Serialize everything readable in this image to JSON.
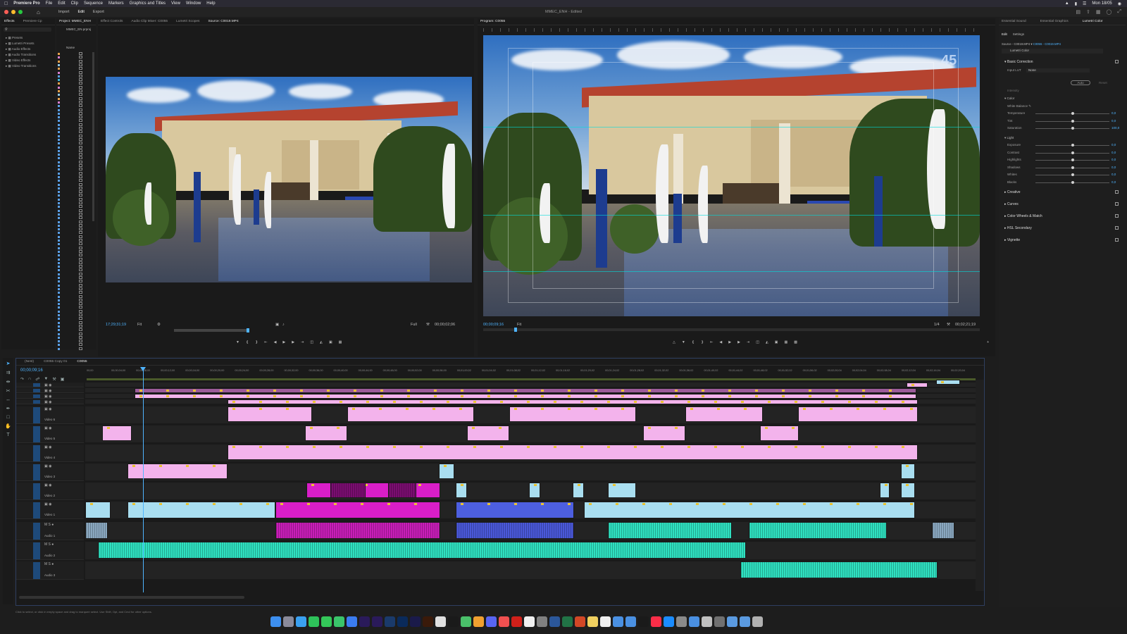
{
  "menubar": {
    "apple": "",
    "app_name": "Premiere Pro",
    "items": [
      "File",
      "Edit",
      "Clip",
      "Sequence",
      "Markers",
      "Graphics and Titles",
      "View",
      "Window",
      "Help"
    ],
    "clock": "Mon 18/05"
  },
  "header": {
    "modes": [
      "Import",
      "Edit",
      "Export"
    ],
    "active_mode": "Edit",
    "doc_title": "MMEC_ENH - Edited"
  },
  "effects_panel": {
    "tabs": [
      "Effects",
      "Premiere Cp"
    ],
    "tree": [
      "Presets",
      "Lumetri Presets",
      "Audio Effects",
      "Audio Transitions",
      "Video Effects",
      "Video Transitions"
    ]
  },
  "project_panel": {
    "title": "Project: MMEC_ENH",
    "file": "MMEC_EN.prproj",
    "column": "Name"
  },
  "source_monitor": {
    "tabs": [
      "Effect Controls",
      "Audio Clip Mixer: C0055",
      "Lumetri Scopes",
      "Source: C0019.MP4"
    ],
    "timecode_in": "17;29;31;19",
    "fit": "Fit",
    "quality": "Full",
    "duration": "00;00;02;06"
  },
  "program_monitor": {
    "title": "Program: C0055",
    "timecode": "00;00;09;16",
    "fit": "Fit",
    "quality": "1/4",
    "duration": "00;02;21;19",
    "watermark": "45"
  },
  "lumetri": {
    "tabs": [
      "Essential Sound",
      "Essential Graphics",
      "Lumetri Color"
    ],
    "subtabs": [
      "Edit",
      "Settings"
    ],
    "source": "Source - C0019.MP4",
    "target": "C0055 - C0019.MP4",
    "preset": "Lumetri Color",
    "sections": [
      "Basic Correction",
      "Creative",
      "Curves",
      "Color Wheels & Match",
      "HSL Secondary",
      "Vignette"
    ],
    "input_lut_label": "Input LUT",
    "input_lut_value": "None",
    "auto_label": "Auto",
    "reset_label": "Reset",
    "intensity_label": "Intensity",
    "color_label": "Color",
    "white_balance_label": "White Balance",
    "color_sliders": [
      {
        "label": "Temperature",
        "value": "0,0",
        "pos": 0.5
      },
      {
        "label": "Tint",
        "value": "0,0",
        "pos": 0.5
      },
      {
        "label": "Saturation",
        "value": "100,0",
        "pos": 0.5
      }
    ],
    "light_label": "Light",
    "light_sliders": [
      {
        "label": "Exposure",
        "value": "0,0",
        "pos": 0.5
      },
      {
        "label": "Contrast",
        "value": "0,0",
        "pos": 0.5
      },
      {
        "label": "Highlights",
        "value": "0,0",
        "pos": 0.5
      },
      {
        "label": "Shadows",
        "value": "0,0",
        "pos": 0.5
      },
      {
        "label": "Whites",
        "value": "0,0",
        "pos": 0.5
      },
      {
        "label": "Blacks",
        "value": "0,0",
        "pos": 0.5
      }
    ]
  },
  "timeline": {
    "tabs": [
      "(Nest)",
      "C0055 Copy 01",
      "C0055"
    ],
    "active_tab": "C0055",
    "timecode": "00;00;09;16",
    "ruler": [
      "00;00",
      "00;00;04;00",
      "00;00;08;00",
      "00;00;12;00",
      "00;00;16;00",
      "00;00;20;00",
      "00;00;24;00",
      "00;00;28;00",
      "00;00;32;00",
      "00;00;36;00",
      "00;00;40;00",
      "00;00;44;00",
      "00;00;48;00",
      "00;00;52;00",
      "00;00;56;00",
      "00;01;00;02",
      "00;01;04;02",
      "00;01;08;02",
      "00;01;12;02",
      "00;01;16;02",
      "00;01;20;02",
      "00;01;24;02",
      "00;01;28;02",
      "00;01;32;02",
      "00;01;36;02",
      "00;01;40;02",
      "00;01;44;02",
      "00;01;48;02",
      "00;01;52;02",
      "00;01;56;02",
      "00;02;00;04",
      "00;02;04;04",
      "00;02;08;04",
      "00;02;12;04",
      "00;02;16;04",
      "00;02;20;04"
    ],
    "video_tracks": [
      "Video 6",
      "Video 5",
      "Video 4",
      "Video 3",
      "Video 2",
      "Video 1"
    ],
    "audio_tracks": [
      "Audio 1",
      "Audio 2",
      "Audio 3"
    ]
  },
  "status": {
    "hint": "Click to select, or click in empty space and drag to marquee select. Use Shift, Opt, and Cmd for other options."
  },
  "dock_apps": [
    "finder",
    "launchpad",
    "safari",
    "whatsapp",
    "messages",
    "facetime",
    "mail",
    "after-effects",
    "premiere",
    "lightroom-classic",
    "photoshop",
    "media-encoder",
    "illustrator",
    "chrome",
    "capcut",
    "maps",
    "photos",
    "discord",
    "music-app",
    "acrobat",
    "calendar",
    "calculator",
    "word",
    "excel",
    "powerpoint",
    "notes",
    "reminders",
    "preview",
    "finder-2",
    "tv",
    "music",
    "app-store",
    "system-preferences",
    "network",
    "font-book",
    "screenshot",
    "downloads",
    "folder",
    "trash"
  ]
}
